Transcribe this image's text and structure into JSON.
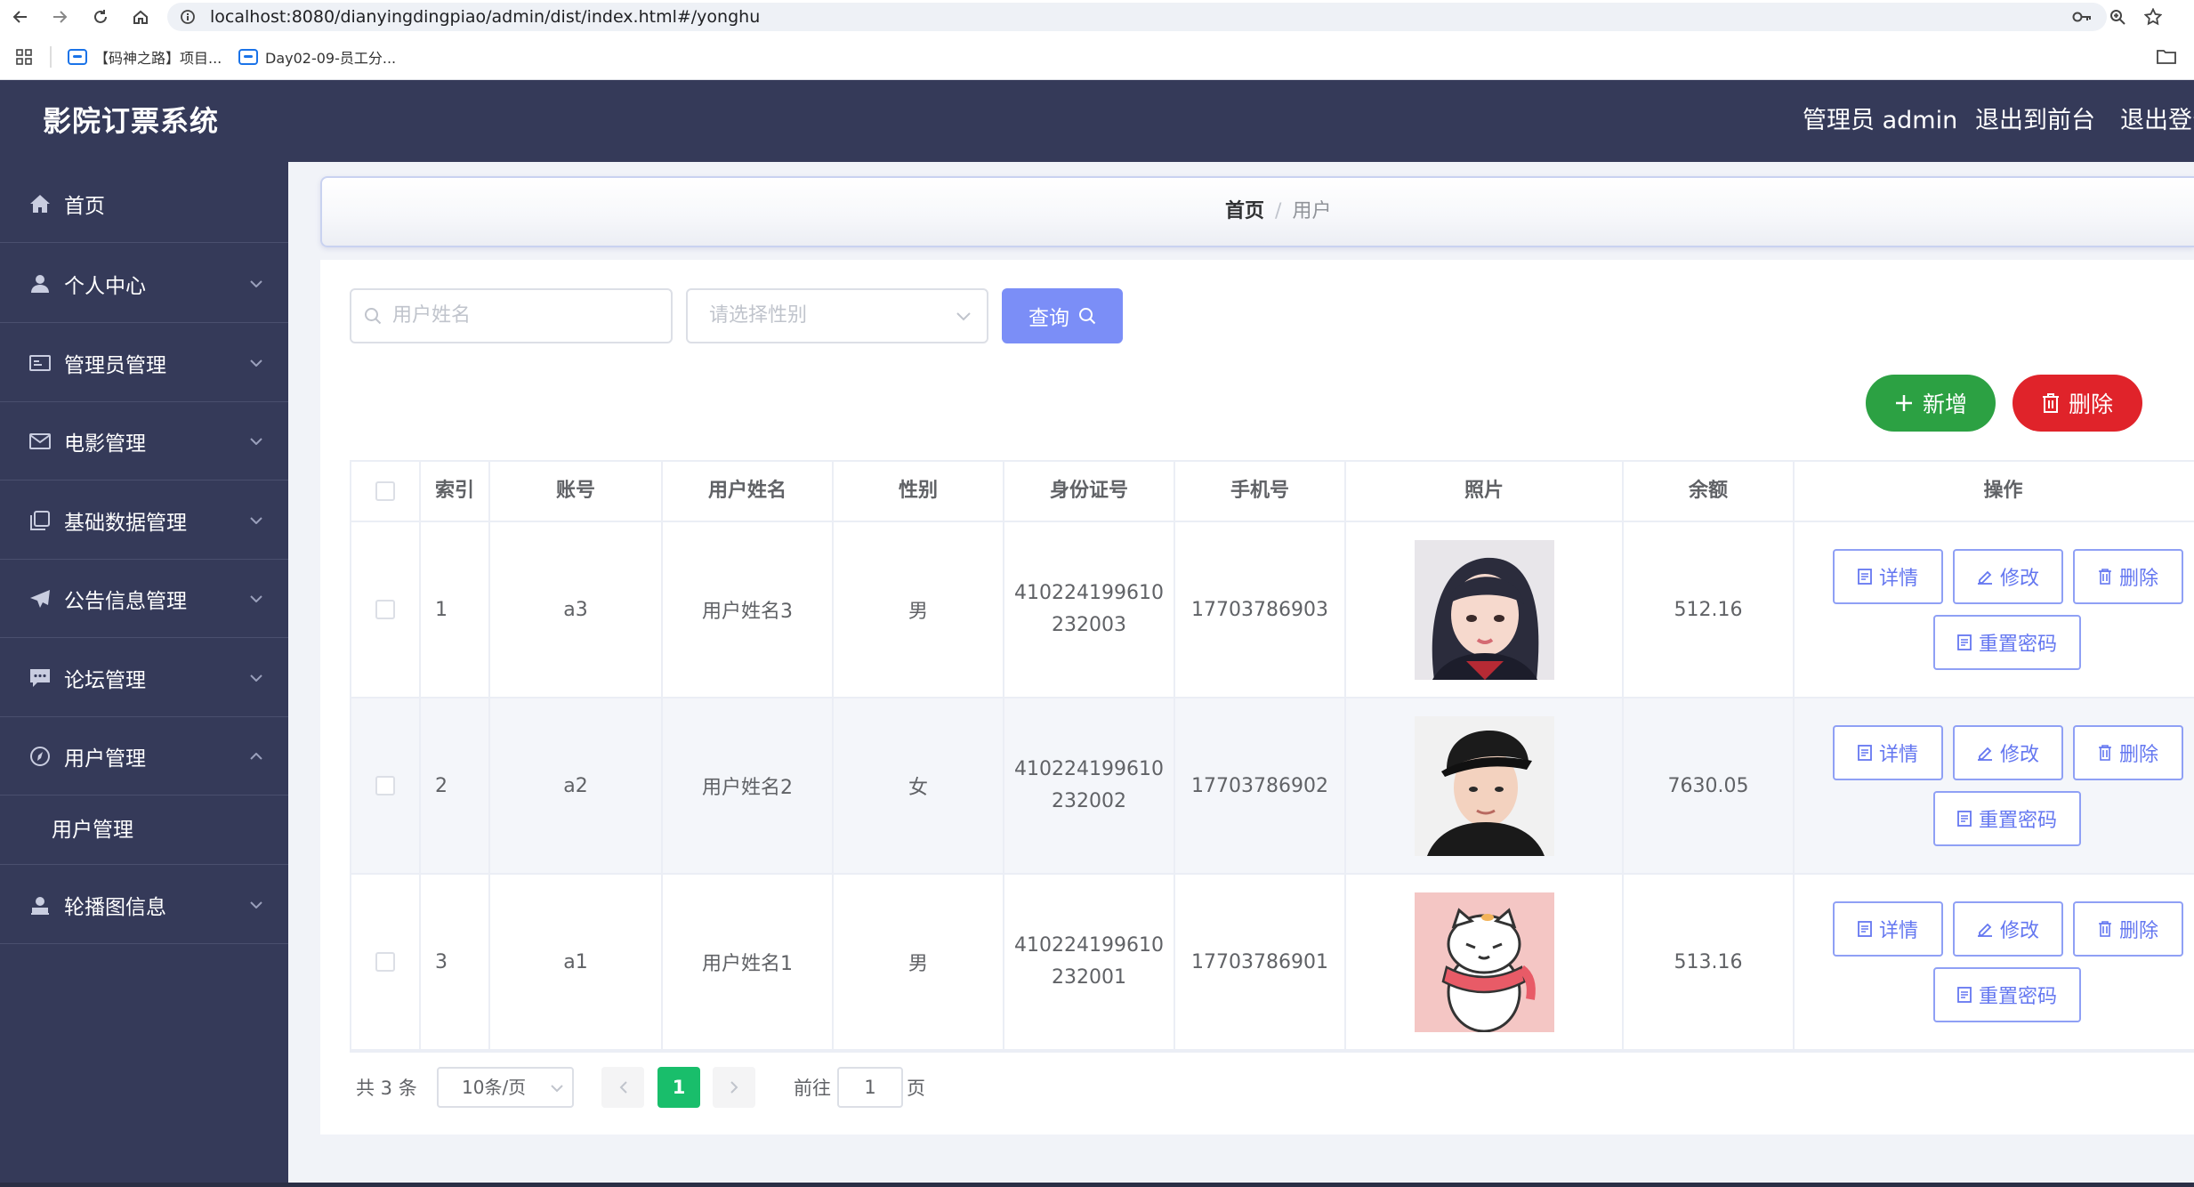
{
  "browser": {
    "url": "localhost:8080/dianyingdingpiao/admin/dist/index.html#/yonghu",
    "bookmarks": [
      {
        "label": "【码神之路】项目..."
      },
      {
        "label": "Day02-09-员工分..."
      }
    ]
  },
  "header": {
    "title": "影院订票系统",
    "admin_label": "管理员 admin",
    "back_front": "退出到前台",
    "logout": "退出登录"
  },
  "sidebar": {
    "items": [
      {
        "label": "首页",
        "icon": "home-icon"
      },
      {
        "label": "个人中心",
        "icon": "user-icon"
      },
      {
        "label": "管理员管理",
        "icon": "id-card-icon"
      },
      {
        "label": "电影管理",
        "icon": "mail-icon"
      },
      {
        "label": "基础数据管理",
        "icon": "copy-icon"
      },
      {
        "label": "公告信息管理",
        "icon": "send-icon"
      },
      {
        "label": "论坛管理",
        "icon": "chat-icon"
      },
      {
        "label": "用户管理",
        "icon": "compass-icon",
        "expanded": true
      },
      {
        "label": "轮播图信息",
        "icon": "avatar-icon"
      }
    ],
    "sub_item": "用户管理"
  },
  "breadcrumb": {
    "home": "首页",
    "separator": "/",
    "current": "用户"
  },
  "search": {
    "username_placeholder": "用户姓名",
    "gender_placeholder": "请选择性别",
    "query_label": "查询"
  },
  "actions": {
    "add_label": "新增",
    "delete_label": "删除"
  },
  "table": {
    "columns": [
      "索引",
      "账号",
      "用户姓名",
      "性别",
      "身份证号",
      "手机号",
      "照片",
      "余额",
      "操作"
    ],
    "rows": [
      {
        "index": "1",
        "account": "a3",
        "name": "用户姓名3",
        "gender": "男",
        "id_line1": "410224199610",
        "id_line2": "232003",
        "phone": "17703786903",
        "balance": "512.16",
        "photo": "girl-portrait"
      },
      {
        "index": "2",
        "account": "a2",
        "name": "用户姓名2",
        "gender": "女",
        "id_line1": "410224199610",
        "id_line2": "232002",
        "phone": "17703786902",
        "balance": "7630.05",
        "photo": "boy-portrait"
      },
      {
        "index": "3",
        "account": "a1",
        "name": "用户姓名1",
        "gender": "男",
        "id_line1": "410224199610",
        "id_line2": "232001",
        "phone": "17703786901",
        "balance": "513.16",
        "photo": "cartoon-cat"
      }
    ],
    "ops": {
      "detail": "详情",
      "edit": "修改",
      "delete": "删除",
      "reset_password": "重置密码"
    }
  },
  "pagination": {
    "total": "共 3 条",
    "page_size": "10条/页",
    "current": "1",
    "goto_label": "前往",
    "goto_value": "1",
    "page_label": "页"
  },
  "colors": {
    "sidebar_bg": "#353a59",
    "primary": "#7b8ef7",
    "success": "#2ca143",
    "danger": "#e0232a",
    "page_active": "#19be6b"
  }
}
